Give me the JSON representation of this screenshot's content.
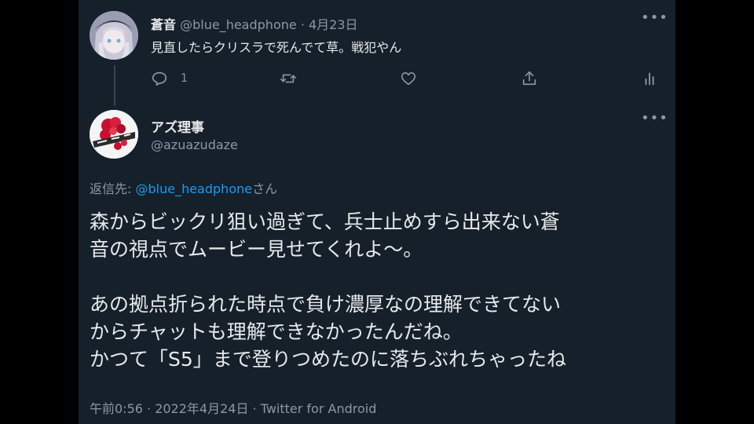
{
  "parent_tweet": {
    "display_name": "蒼音",
    "handle": "@blue_headphone",
    "separator": "·",
    "date": "4月23日",
    "text": "見直したらクリスラで死んでて草。戦犯やん",
    "reply_count": "1",
    "icons": [
      "reply-icon",
      "retweet-icon",
      "like-icon",
      "share-icon",
      "analytics-icon"
    ]
  },
  "main_tweet": {
    "display_name": "アズ理事",
    "handle": "@azuazudaze",
    "reply_prefix": "返信先: ",
    "reply_target": "@blue_headphone",
    "reply_suffix": "さん",
    "body": "森からビックリ狙い過ぎて、兵士止めすら出来ない蒼\n音の視点でムービー見せてくれよ〜。\n\nあの拠点折られた時点で負け濃厚なの理解できてない\nからチャットも理解できなかったんだね。\nかつて「S5」まで登りつめたのに落ちぶれちゃったね",
    "meta": "午前0:56 · 2022年4月24日 · Twitter for Android"
  },
  "more_label": "•••",
  "colors": {
    "background": "#15202b",
    "accent": "#1d9bf0",
    "muted": "#8b98a5"
  }
}
